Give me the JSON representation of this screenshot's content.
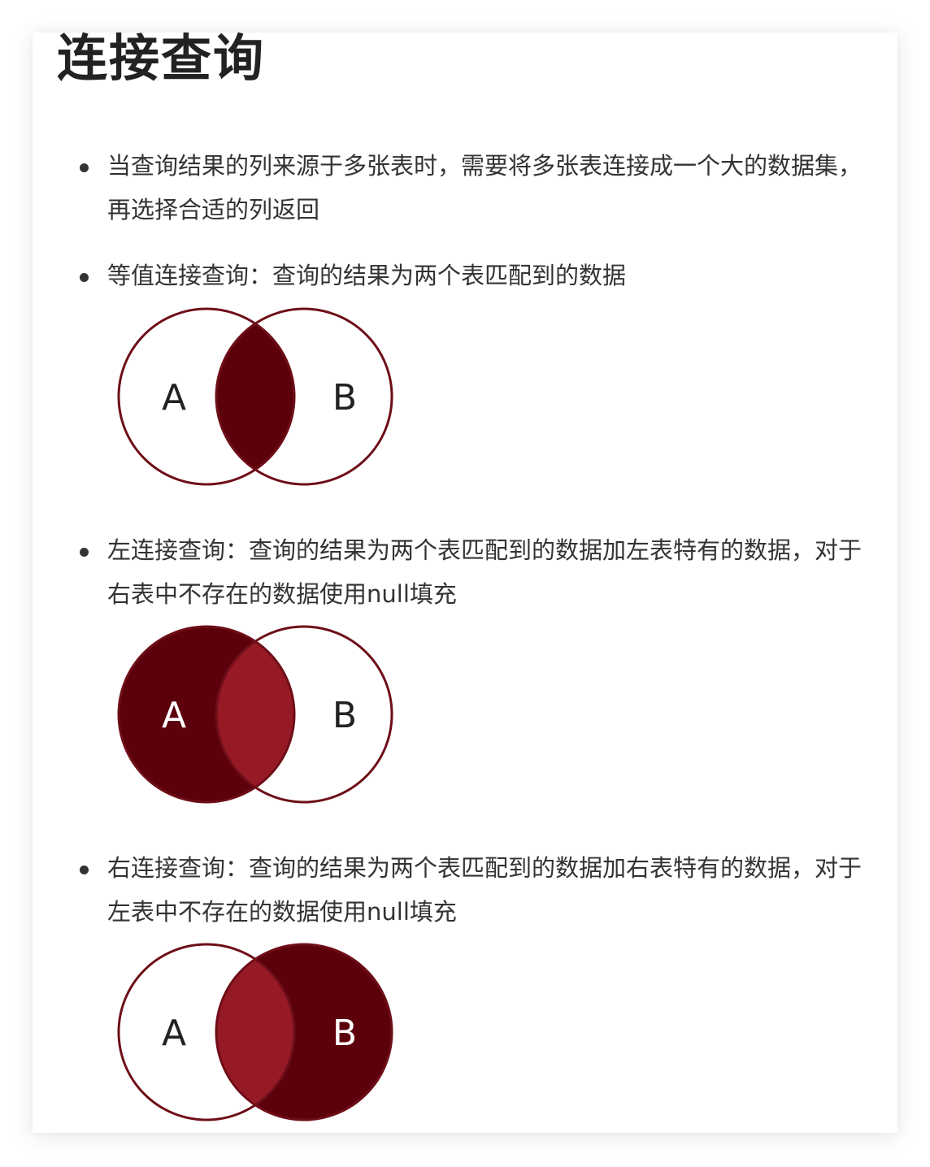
{
  "title": "连接查询",
  "bullets": [
    {
      "text": "当查询结果的列来源于多张表时，需要将多张表连接成一个大的数据集，再选择合适的列返回"
    },
    {
      "text": "等值连接查询：查询的结果为两个表匹配到的数据"
    },
    {
      "text": "左连接查询：查询的结果为两个表匹配到的数据加左表特有的数据，对于右表中不存在的数据使用null填充"
    },
    {
      "text": "右连接查询：查询的结果为两个表匹配到的数据加右表特有的数据，对于左表中不存在的数据使用null填充"
    }
  ],
  "venn": {
    "label_a": "A",
    "label_b": "B",
    "colors": {
      "dark": "#5c000c",
      "mid": "#961a26",
      "outline": "#6e0e18"
    },
    "diagrams": [
      {
        "type": "inner",
        "highlight_a": false,
        "highlight_b": false
      },
      {
        "type": "left",
        "highlight_a": true,
        "highlight_b": false
      },
      {
        "type": "right",
        "highlight_a": false,
        "highlight_b": true
      }
    ]
  }
}
